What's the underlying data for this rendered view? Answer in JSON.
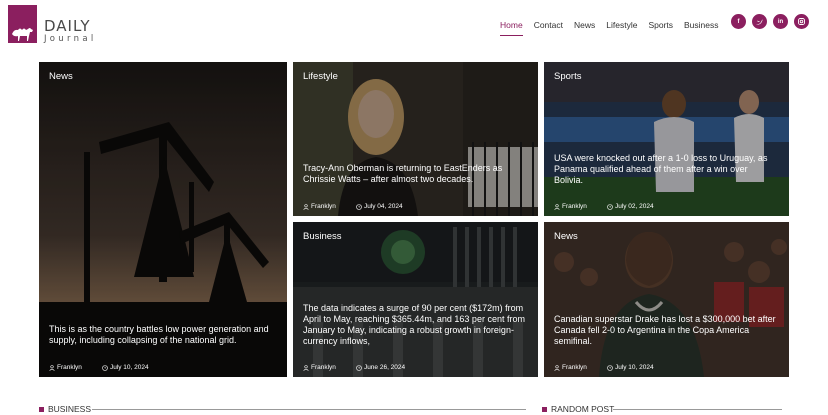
{
  "logo": {
    "title": "DAILY",
    "subtitle": "Journal"
  },
  "nav": [
    "Home",
    "Contact",
    "News",
    "Lifestyle",
    "Sports",
    "Business"
  ],
  "social_icons": [
    "facebook-icon",
    "twitter-icon",
    "linkedin-icon",
    "instagram-icon"
  ],
  "accent_color": "#8b1f5f",
  "cards": [
    {
      "category": "News",
      "headline": "This is as the country battles low power generation and supply, including collapsing of the national grid.",
      "author": "Franklyn",
      "date": "July 10, 2024"
    },
    {
      "category": "Lifestyle",
      "headline": "Tracy-Ann Oberman is returning to EastEnders as Chrissie Watts – after almost two decades.",
      "author": "Franklyn",
      "date": "July 04, 2024"
    },
    {
      "category": "Sports",
      "headline": "USA were knocked out after a 1-0 loss to Uruguay, as Panama qualified ahead of them after a win over Bolivia.",
      "author": "Franklyn",
      "date": "July 02, 2024"
    },
    {
      "category": "Business",
      "headline": "The data indicates a surge of 90 per cent ($172m) from April to May, reaching $365.44m, and 163 per cent from January to May, indicating a robust growth in foreign-currency inflows,",
      "author": "Franklyn",
      "date": "June 26, 2024"
    },
    {
      "category": "News",
      "headline": "Canadian superstar Drake has lost a $300,000 bet after Canada fell 2-0 to Argentina in the Copa America semifinal.",
      "author": "Franklyn",
      "date": "July 10, 2024"
    }
  ],
  "sections": {
    "left": "BUSINESS",
    "right": "RANDOM POST"
  }
}
